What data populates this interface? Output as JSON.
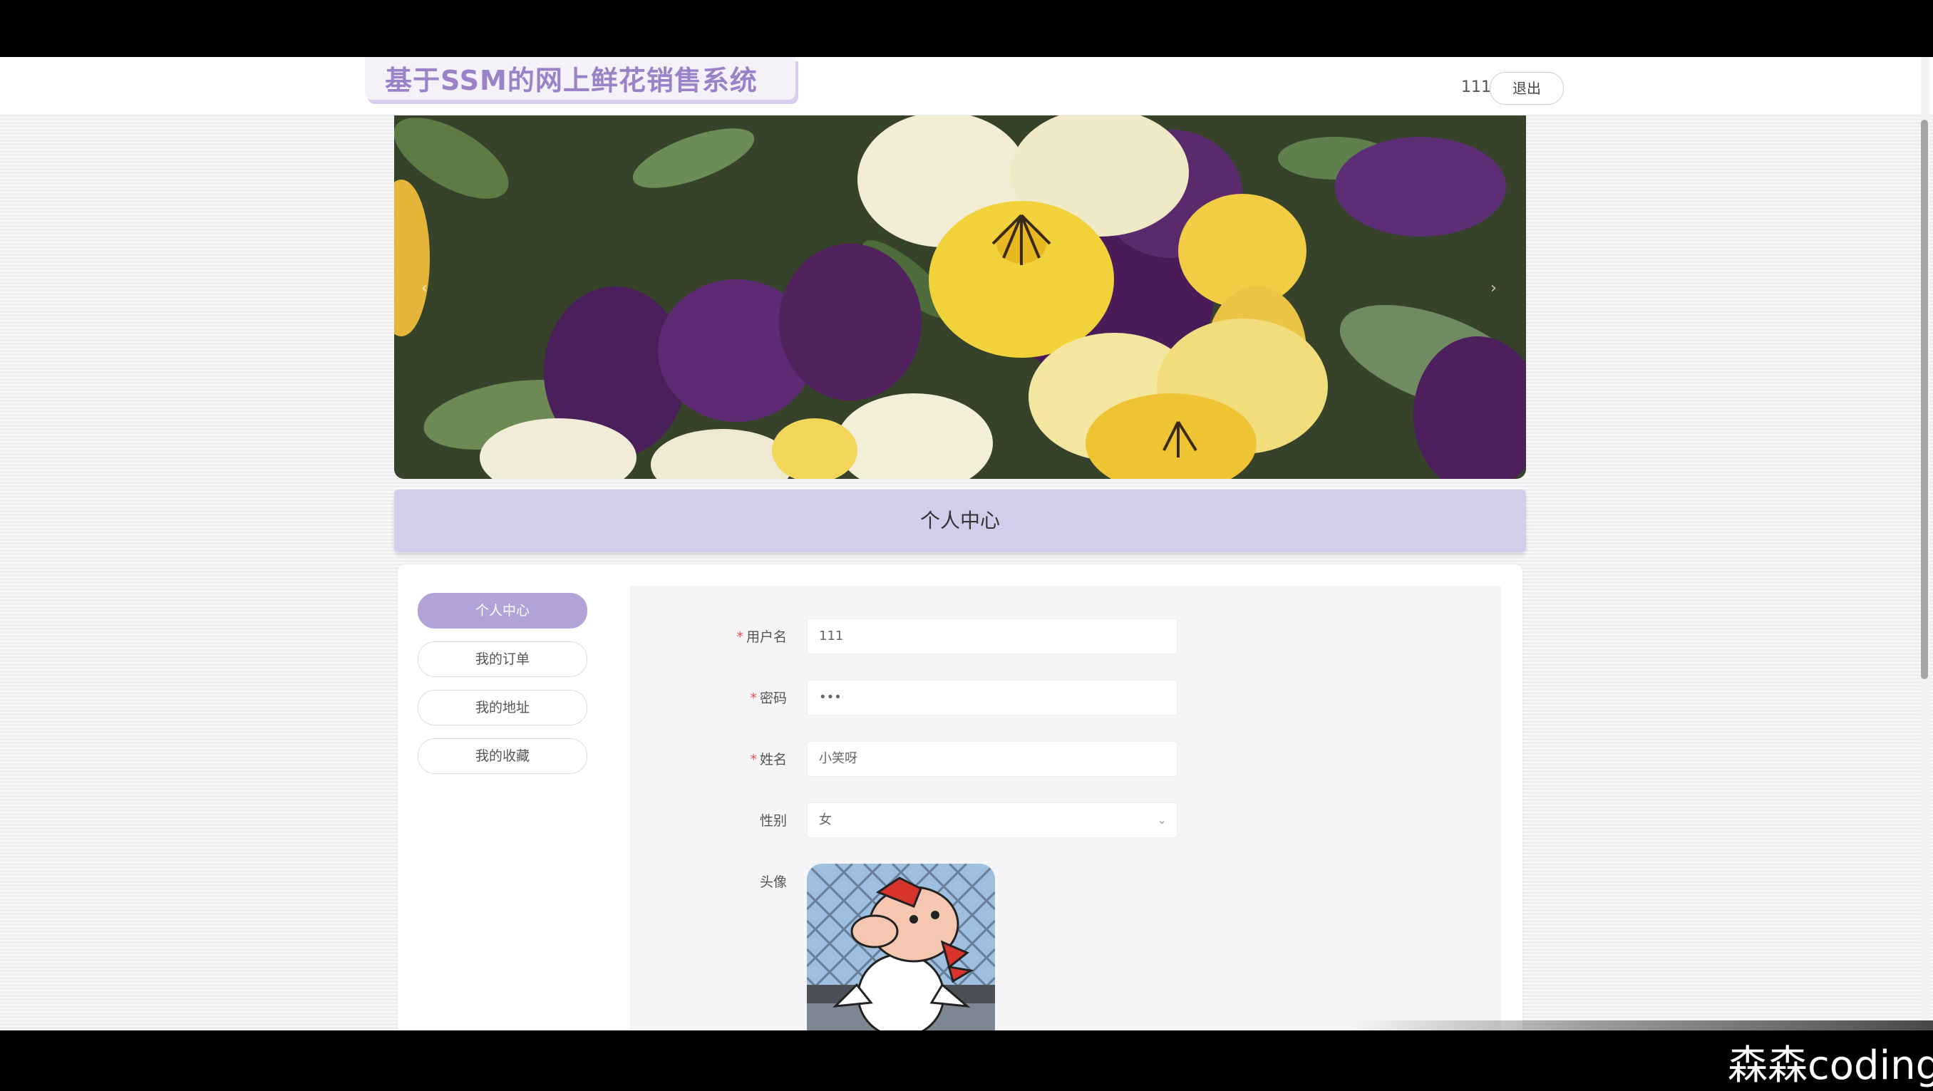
{
  "header": {
    "site_title": "基于SSM的网上鲜花销售系统",
    "username": "111",
    "logout_label": "退出"
  },
  "carousel": {
    "prev_label": "‹",
    "next_label": "›"
  },
  "section": {
    "title": "个人中心"
  },
  "sidebar": {
    "items": [
      {
        "label": "个人中心",
        "active": true
      },
      {
        "label": "我的订单",
        "active": false
      },
      {
        "label": "我的地址",
        "active": false
      },
      {
        "label": "我的收藏",
        "active": false
      }
    ]
  },
  "form": {
    "username": {
      "label": "用户名",
      "value": "111"
    },
    "password": {
      "label": "密码",
      "value": "•••"
    },
    "name": {
      "label": "姓名",
      "value": "小笑呀"
    },
    "gender": {
      "label": "性别",
      "value": "女"
    },
    "avatar": {
      "label": "头像"
    }
  },
  "watermark": "森森coding",
  "colors": {
    "accent": "#b3a2d8",
    "section_header": "#d2cdeb",
    "title_text": "#9b82c8"
  }
}
